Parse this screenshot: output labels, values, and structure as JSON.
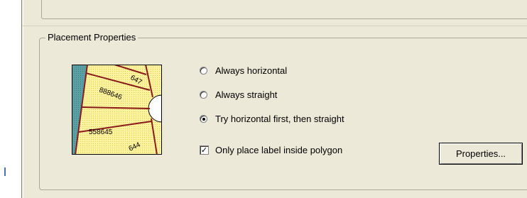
{
  "group": {
    "title": "Placement Properties"
  },
  "preview": {
    "labels": [
      "647",
      "888646",
      "558645",
      "644"
    ],
    "colors": {
      "parcel_fill": "#fff3a0",
      "parcel_border": "#8b1a1a",
      "water": "#5aa0a5",
      "outline": "#000000"
    }
  },
  "placement": {
    "options": [
      {
        "label": "Always horizontal",
        "selected": false
      },
      {
        "label": "Always straight",
        "selected": false
      },
      {
        "label": "Try horizontal first, then straight",
        "selected": true
      }
    ],
    "properties_button": "Properties...",
    "inside_polygon": {
      "label": "Only place label inside polygon",
      "checked": true,
      "mark": "✓"
    }
  }
}
